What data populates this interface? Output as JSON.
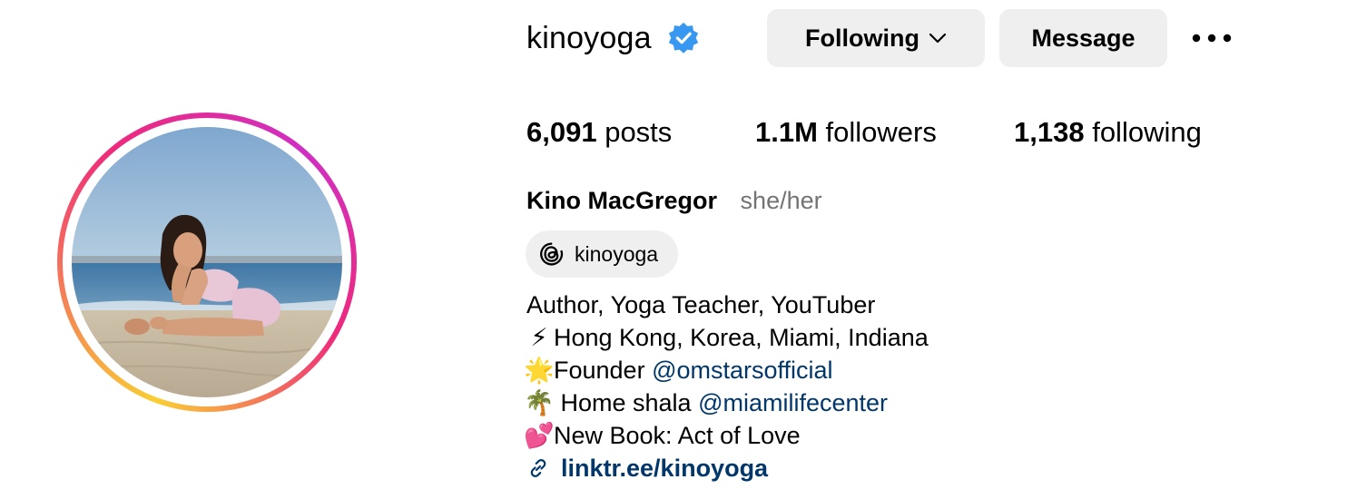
{
  "profile": {
    "username": "kinoyoga",
    "verified": true,
    "verified_icon": "verified-badge-icon",
    "accent_color": "#3897f0"
  },
  "actions": {
    "following_label": "Following",
    "message_label": "Message",
    "more_icon": "more-horizontal-icon"
  },
  "stats": {
    "posts_count": "6,091",
    "posts_label": "posts",
    "followers_count": "1.1M",
    "followers_label": "followers",
    "following_count": "1,138",
    "following_label": "following"
  },
  "bio": {
    "full_name": "Kino MacGregor",
    "pronouns": "she/her",
    "threads_handle": "kinoyoga",
    "lines": [
      {
        "emoji": "",
        "text": "Author, Yoga Teacher, YouTuber",
        "mention": ""
      },
      {
        "emoji": "⚡",
        "text": "Hong Kong, Korea, Miami, Indiana",
        "mention": ""
      },
      {
        "emoji": "🌟",
        "text": "Founder ",
        "mention": "@omstarsofficial"
      },
      {
        "emoji": "🌴",
        "text": " Home shala ",
        "mention": "@miamilifecenter"
      },
      {
        "emoji": "💕",
        "text": "New Book: Act of Love",
        "mention": ""
      }
    ],
    "link": "linktr.ee/kinoyoga"
  },
  "colors": {
    "button_bg": "#efefef",
    "link_color": "#00376b",
    "secondary_text": "#737373"
  }
}
